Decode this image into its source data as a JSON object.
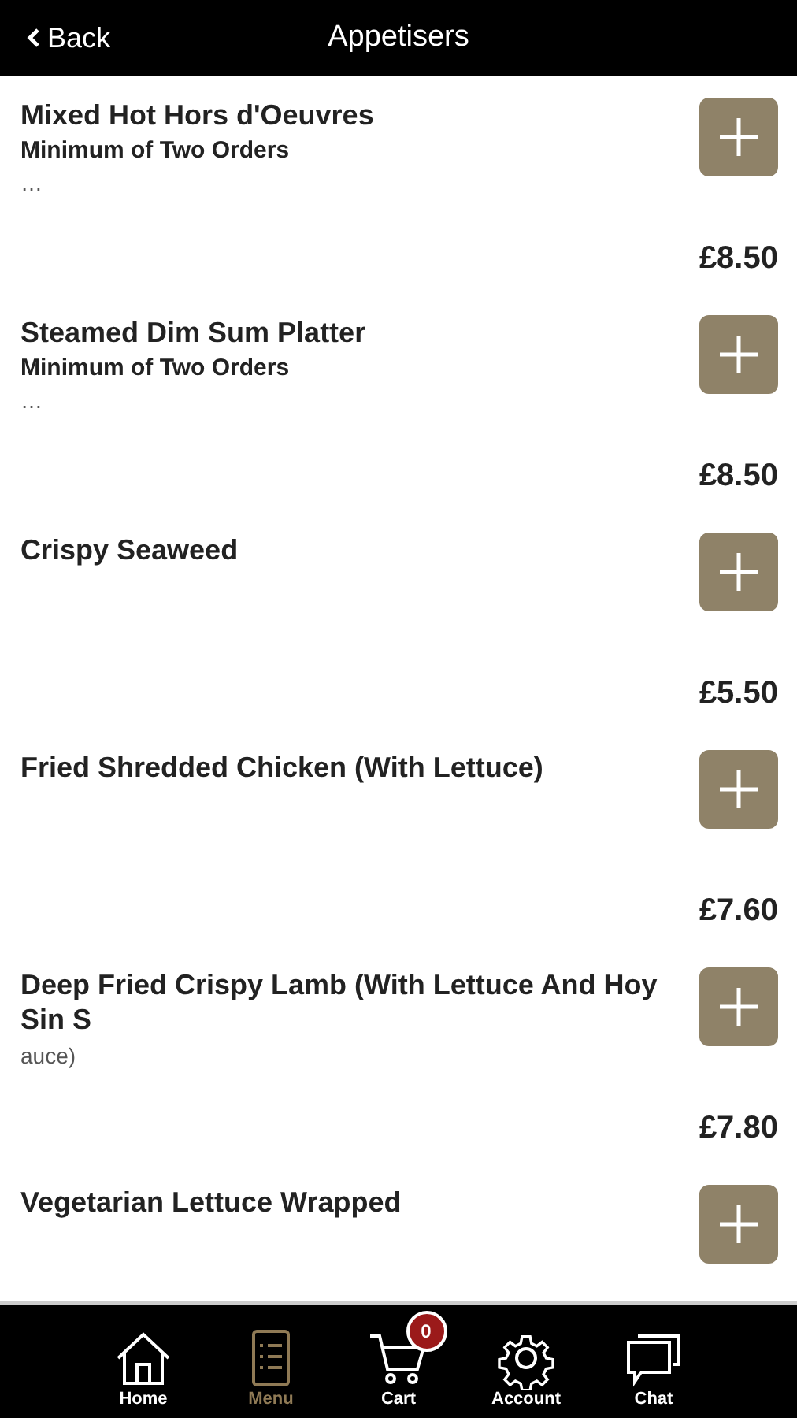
{
  "header": {
    "back": "Back",
    "title": "Appetisers"
  },
  "items": [
    {
      "name": "Mixed Hot Hors d'Oeuvres",
      "subtitle": "Minimum of Two Orders",
      "note": "…",
      "price": "£8.50"
    },
    {
      "name": "Steamed Dim Sum Platter",
      "subtitle": "Minimum of Two Orders",
      "note": "…",
      "price": "£8.50"
    },
    {
      "name": "Crispy Seaweed",
      "price": "£5.50"
    },
    {
      "name": "Fried Shredded Chicken (With Lettuce)",
      "price": "£7.60"
    },
    {
      "name": "Deep Fried Crispy Lamb (With Lettuce And Hoy Sin S",
      "note": "auce)",
      "price": "£7.80"
    },
    {
      "name": "Vegetarian Lettuce Wrapped"
    }
  ],
  "tabs": [
    {
      "kind": "home",
      "label": "Home",
      "selected": false
    },
    {
      "kind": "menu",
      "label": "Menu",
      "selected": true
    },
    {
      "kind": "cart",
      "label": "Cart",
      "selected": false,
      "badge": "0"
    },
    {
      "kind": "account",
      "label": "Account",
      "selected": false
    },
    {
      "kind": "chat",
      "label": "Chat",
      "selected": false
    }
  ]
}
